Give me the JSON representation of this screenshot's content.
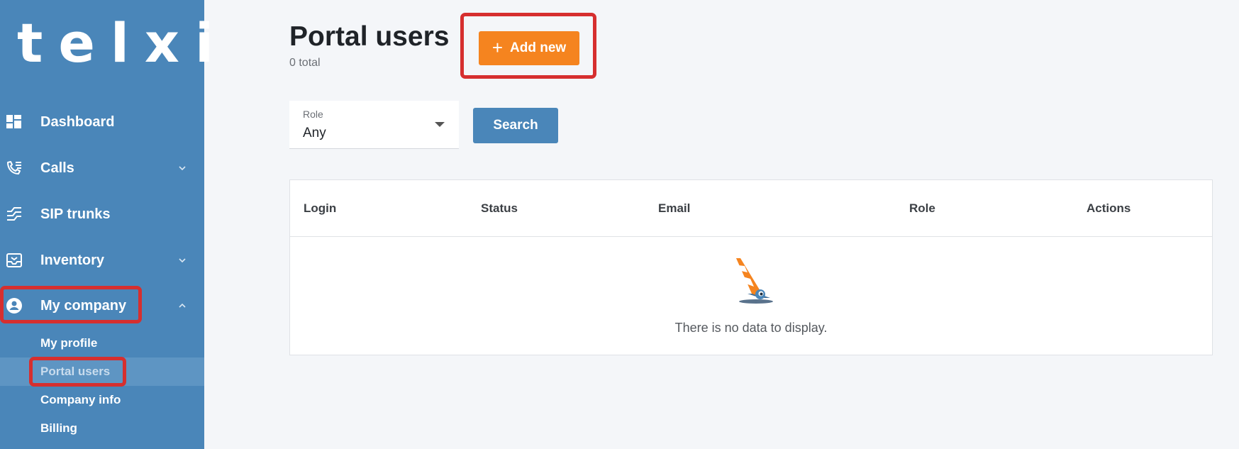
{
  "brand": {
    "logo": "telxi"
  },
  "sidebar": {
    "items": [
      {
        "label": "Dashboard",
        "icon": "dashboard-icon",
        "chevron": ""
      },
      {
        "label": "Calls",
        "icon": "phone-icon",
        "chevron": "chevron-down"
      },
      {
        "label": "SIP trunks",
        "icon": "sip-trunks-icon",
        "chevron": ""
      },
      {
        "label": "Inventory",
        "icon": "inbox-icon",
        "chevron": "chevron-down"
      },
      {
        "label": "My company",
        "icon": "account-circle-icon",
        "chevron": "chevron-up"
      }
    ],
    "subitems": [
      {
        "label": "My profile",
        "active": false
      },
      {
        "label": "Portal users",
        "active": true
      },
      {
        "label": "Company info",
        "active": false
      },
      {
        "label": "Billing",
        "active": false
      }
    ]
  },
  "main": {
    "title": "Portal users",
    "count": "0 total",
    "add_button": "Add new",
    "filter": {
      "label": "Role",
      "value": "Any"
    },
    "search_button": "Search",
    "table": {
      "columns": [
        "Login",
        "Status",
        "Email",
        "Role",
        "Actions"
      ],
      "empty_text": "There is no data to display."
    }
  },
  "colors": {
    "sidebar": "#4a86b9",
    "accent": "#f5841f",
    "primary": "#4a86b9",
    "highlight": "#d62f2f",
    "background": "#f4f6f9"
  }
}
